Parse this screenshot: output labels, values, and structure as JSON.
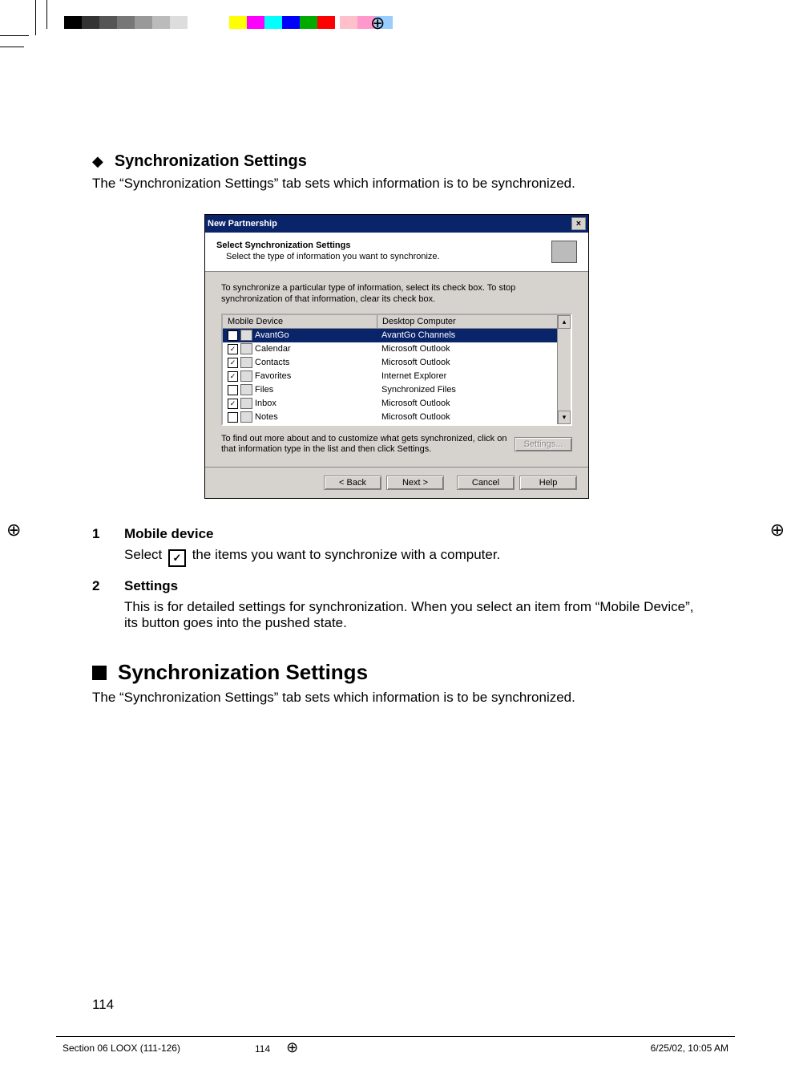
{
  "heading1": {
    "title": "Synchronization Settings"
  },
  "intro1": "The “Synchronization Settings” tab sets which information is to be synchronized.",
  "dialog": {
    "title": "New Partnership",
    "wizard_title": "Select Synchronization Settings",
    "wizard_subtitle": "Select the type of information you want to synchronize.",
    "intro": "To synchronize a particular type of information, select its check box. To stop synchronization of that information, clear its check box.",
    "col1": "Mobile Device",
    "col2": "Desktop Computer",
    "rows": [
      {
        "checked": false,
        "name": "AvantGo",
        "desktop": "AvantGo Channels",
        "selected": true
      },
      {
        "checked": true,
        "name": "Calendar",
        "desktop": "Microsoft Outlook",
        "selected": false
      },
      {
        "checked": true,
        "name": "Contacts",
        "desktop": "Microsoft Outlook",
        "selected": false
      },
      {
        "checked": true,
        "name": "Favorites",
        "desktop": "Internet Explorer",
        "selected": false
      },
      {
        "checked": false,
        "name": "Files",
        "desktop": "Synchronized Files",
        "selected": false
      },
      {
        "checked": true,
        "name": "Inbox",
        "desktop": "Microsoft Outlook",
        "selected": false
      },
      {
        "checked": false,
        "name": "Notes",
        "desktop": "Microsoft Outlook",
        "selected": false
      }
    ],
    "footnote": "To find out more about and to customize what gets synchronized, click on that information type in the list and then click Settings.",
    "settings_btn": "Settings...",
    "back": "< Back",
    "next": "Next >",
    "cancel": "Cancel",
    "help": "Help"
  },
  "step1": {
    "num": "1",
    "title": "Mobile device",
    "body_before": "Select ",
    "body_after": " the items you want to synchronize with a computer."
  },
  "step2": {
    "num": "2",
    "title": "Settings",
    "body": "This is for detailed settings for synchronization. When you select an item from “Mobile Device”, its button goes into the pushed state."
  },
  "heading2": {
    "title": "Synchronization Settings"
  },
  "intro2": "The “Synchronization Settings” tab sets which information is to be synchronized.",
  "page_number": "114",
  "footer": {
    "section": "Section 06 LOOX (111-126)",
    "page": "114",
    "datetime": "6/25/02, 10:05 AM"
  },
  "colorbar": [
    "#000",
    "#333",
    "#555",
    "#777",
    "#999",
    "#bbb",
    "#ddd",
    "#fff",
    "",
    "",
    "",
    "",
    "",
    "#ff0",
    "#f0f",
    "#0ff",
    "#00f",
    "#0a0",
    "#f00",
    "",
    "#ffc0cb",
    "#f9c",
    "#9cf"
  ]
}
